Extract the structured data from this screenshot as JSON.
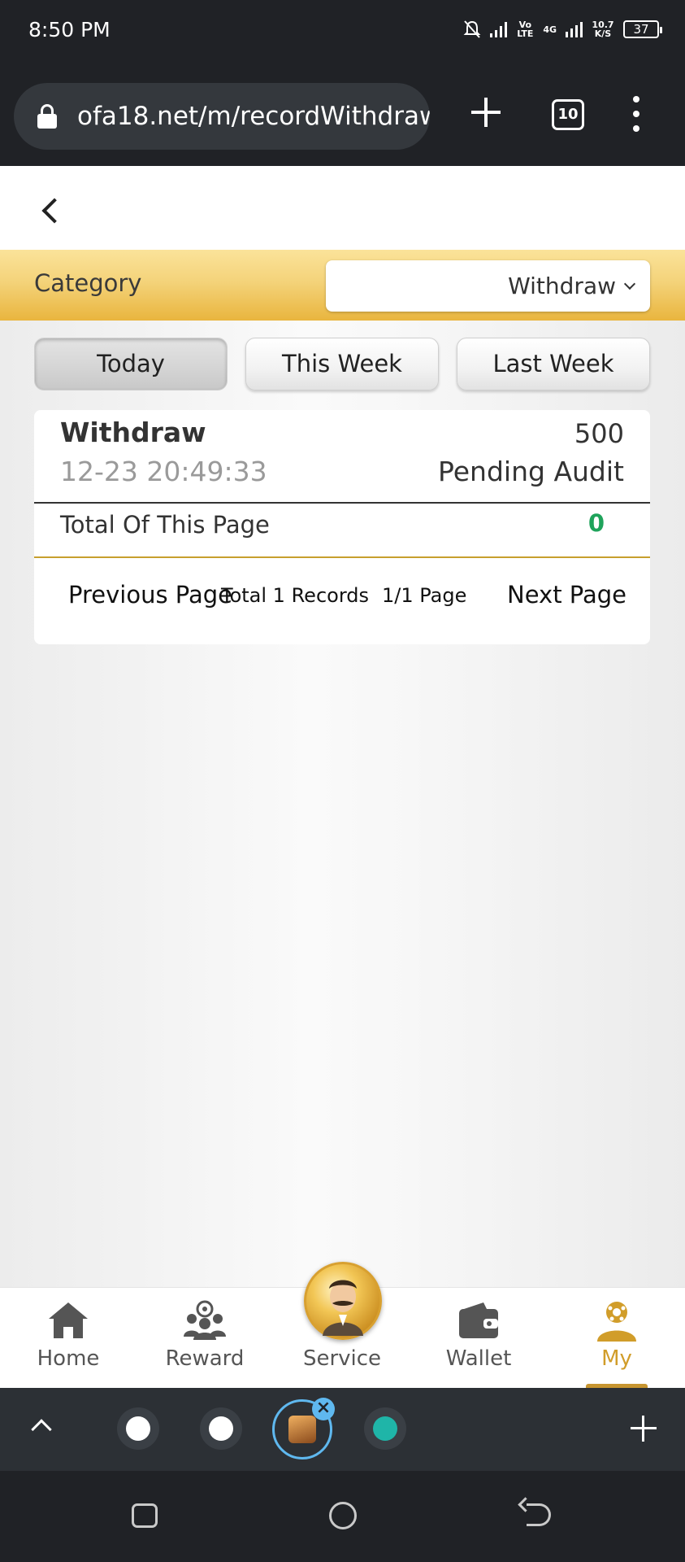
{
  "status_bar": {
    "time": "8:50 PM",
    "icons": [
      "mute-bell-icon",
      "signal-icon",
      "volte-icon",
      "4g-signal-icon",
      "data-speed-icon",
      "battery-icon"
    ],
    "volte": "Vo LTE",
    "network": "4G",
    "speed": "10.7 K/S",
    "battery": "37"
  },
  "browser": {
    "url": "ofa18.net/m/recordWithdraw",
    "tab_count": "10"
  },
  "category": {
    "label": "Category",
    "selected": "Withdraw"
  },
  "tabs": [
    {
      "label": "Today",
      "active": true
    },
    {
      "label": "This Week",
      "active": false
    },
    {
      "label": "Last Week",
      "active": false
    }
  ],
  "record": {
    "type": "Withdraw",
    "amount": "500",
    "time": "12-23 20:49:33",
    "status": "Pending Audit"
  },
  "total": {
    "label": "Total Of This Page",
    "value": "0",
    "value_color": "#1fa35b"
  },
  "pager": {
    "prev": "Previous Page",
    "total_records": "Total 1 Records",
    "pages": "1/1 Page",
    "next": "Next Page"
  },
  "bottom_nav": [
    {
      "label": "Home",
      "icon": "home-icon"
    },
    {
      "label": "Reward",
      "icon": "reward-icon"
    },
    {
      "label": "Service",
      "icon": "service-avatar-icon"
    },
    {
      "label": "Wallet",
      "icon": "wallet-icon"
    },
    {
      "label": "My",
      "icon": "my-profile-icon",
      "active": true
    }
  ],
  "colors": {
    "accent_gold": "#d19d2a",
    "status_bar_bg": "#202226"
  }
}
